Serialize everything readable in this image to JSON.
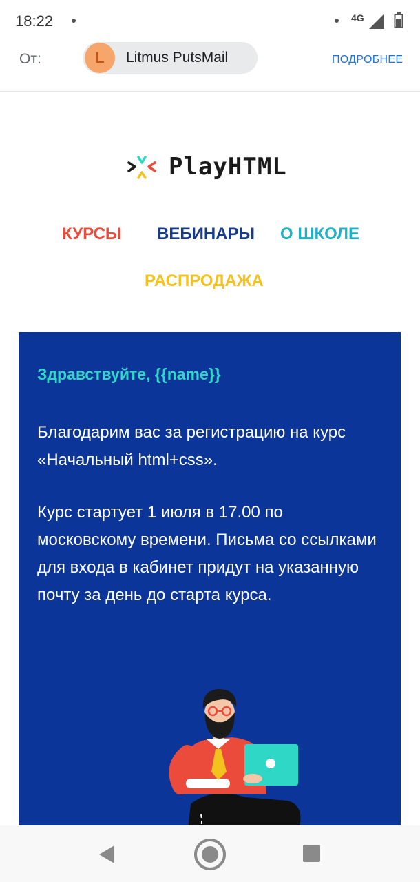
{
  "status_bar": {
    "time": "18:22",
    "network": "4G",
    "icons": [
      "notification-dot-icon",
      "signal-icon",
      "battery-icon"
    ]
  },
  "header": {
    "from_label": "От:",
    "sender_initial": "L",
    "sender_name": "Litmus PutsMail",
    "details_link": "ПОДРОБНЕЕ",
    "avatar_color": "#f7a66b"
  },
  "email": {
    "logo_text": "PlayHTML",
    "nav": {
      "courses": "КУРСЫ",
      "webinars": "ВЕБИНАРЫ",
      "about": "О ШКОЛЕ",
      "sale": "РАСПРОДАЖА"
    },
    "nav_colors": {
      "courses": "#ea4b3b",
      "webinars": "#173a8a",
      "about": "#1fb2c6",
      "sale": "#f4c21f"
    },
    "greeting": "Здравствуйте, {{name}}",
    "paragraph_1": "Благодарим вас за регистрацию на курс «Начальный html+css».",
    "paragraph_2": "Курс стартует 1 июля в 17.00 по московскому времени. Письма со ссылками для входа в кабинет придут на указанную почту за день до старта курса.",
    "card_color": "#0b3599",
    "accent_color": "#2fd8c6"
  },
  "navigation_bar": {
    "icons": [
      "back-icon",
      "home-icon",
      "recents-icon"
    ]
  }
}
